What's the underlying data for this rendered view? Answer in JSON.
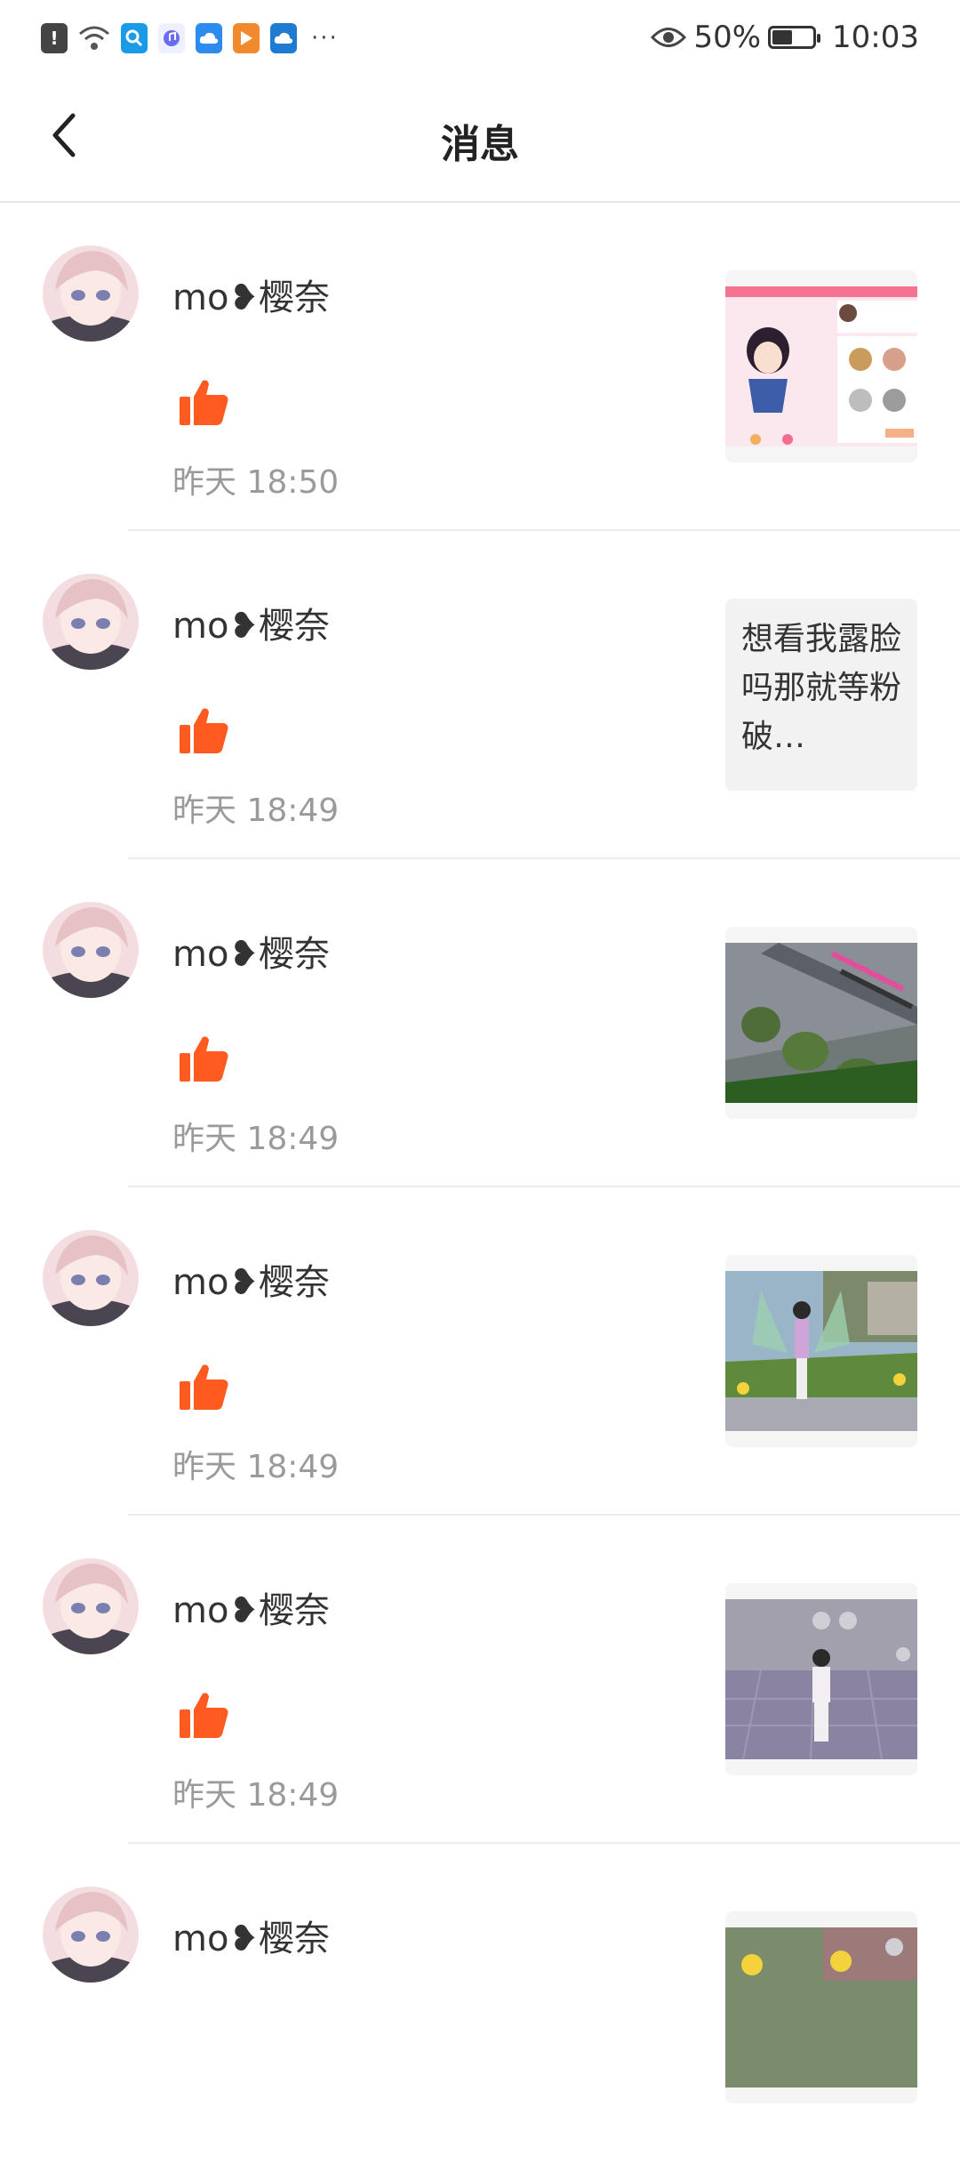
{
  "status_bar": {
    "battery_percent": "50%",
    "time": "10:03",
    "battery_level": 0.5
  },
  "header": {
    "title": "消息"
  },
  "messages": [
    {
      "username": "mo❥樱奈",
      "time": "昨天 18:50",
      "thumb_type": "game-ui"
    },
    {
      "username": "mo❥樱奈",
      "time": "昨天 18:49",
      "thumb_type": "text",
      "thumb_text": "想看我露脸吗那就等粉破…"
    },
    {
      "username": "mo❥樱奈",
      "time": "昨天 18:49",
      "thumb_type": "blurry-scene"
    },
    {
      "username": "mo❥樱奈",
      "time": "昨天 18:49",
      "thumb_type": "fairy-scene"
    },
    {
      "username": "mo❥樱奈",
      "time": "昨天 18:49",
      "thumb_type": "schoolyard-scene"
    },
    {
      "username": "mo❥樱奈",
      "time": "",
      "thumb_type": "garden-scene"
    }
  ],
  "colors": {
    "like": "#ff5a1f",
    "divider": "#ececec",
    "timestamp": "#9a9a9a"
  }
}
